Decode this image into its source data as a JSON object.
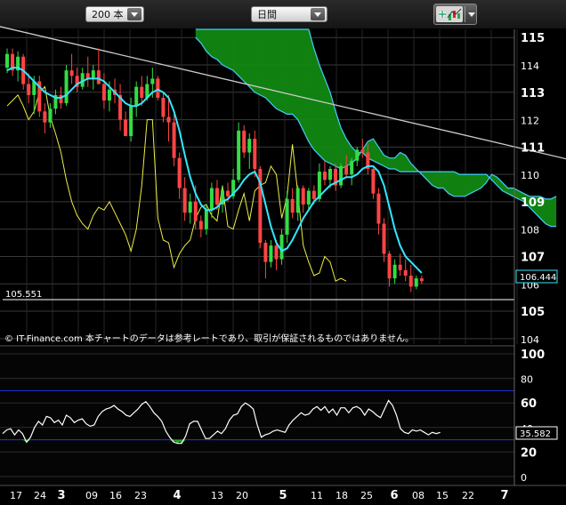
{
  "toolbar": {
    "count_select": "200 本",
    "period_select": "日間"
  },
  "icons": {
    "drawing_tools": "chart-draw-icon",
    "dropdown": "chevron-down-icon"
  },
  "colors": {
    "up_candle": "#33dd44",
    "down_candle": "#ff4444",
    "ma_line": "#33e6ff",
    "chikou_line": "#eeee44",
    "cloud_fill": "#118811",
    "cloud_edge": "#44ccff",
    "trendline": "#cccccc",
    "rsi_line": "#ffffff",
    "rsi_band": "#2233ee"
  },
  "price_panel": {
    "y_ticks": [
      "115",
      "114",
      "113",
      "112",
      "111",
      "110",
      "109",
      "108",
      "107",
      "106",
      "105",
      "104"
    ],
    "hline_label": "105.551",
    "last_price_label": "106.444",
    "copyright": "© IT-Finance.com  本チャートのデータは参考レートであり、取引が保証されるものではありません。"
  },
  "rsi_panel": {
    "y_ticks": [
      "100",
      "80",
      "60",
      "40",
      "20",
      "0"
    ],
    "last_value_label": "35.582"
  },
  "x_axis": {
    "ticks": [
      {
        "label": "17",
        "bold": false
      },
      {
        "label": "24",
        "bold": false
      },
      {
        "label": "3",
        "bold": true
      },
      {
        "label": "09",
        "bold": false
      },
      {
        "label": "16",
        "bold": false
      },
      {
        "label": "23",
        "bold": false
      },
      {
        "label": "4",
        "bold": true
      },
      {
        "label": "13",
        "bold": false
      },
      {
        "label": "20",
        "bold": false
      },
      {
        "label": "5",
        "bold": true
      },
      {
        "label": "11",
        "bold": false
      },
      {
        "label": "18",
        "bold": false
      },
      {
        "label": "25",
        "bold": false
      },
      {
        "label": "6",
        "bold": true
      },
      {
        "label": "08",
        "bold": false
      },
      {
        "label": "15",
        "bold": false
      },
      {
        "label": "22",
        "bold": false
      },
      {
        "label": "7",
        "bold": true
      }
    ]
  },
  "chart_data": {
    "type": "candlestick",
    "price": {
      "ylim": [
        103.8,
        115.3
      ],
      "y_ticks": [
        115,
        114,
        113,
        112,
        111,
        110,
        109,
        108,
        107,
        106,
        105,
        104
      ],
      "horizontal_line": 105.551,
      "last_price": 106.444,
      "candles_ohlc": [
        [
          113.9,
          114.6,
          113.7,
          114.4
        ],
        [
          114.4,
          114.6,
          113.6,
          113.8
        ],
        [
          113.8,
          114.5,
          113.4,
          114.3
        ],
        [
          114.3,
          114.4,
          113.1,
          113.3
        ],
        [
          113.3,
          113.7,
          112.6,
          112.9
        ],
        [
          112.9,
          113.6,
          112.2,
          113.4
        ],
        [
          113.4,
          113.6,
          112.1,
          112.3
        ],
        [
          112.3,
          112.6,
          111.5,
          111.9
        ],
        [
          111.9,
          112.6,
          111.7,
          112.4
        ],
        [
          112.4,
          113.1,
          112.2,
          112.9
        ],
        [
          112.9,
          113.2,
          112.4,
          112.6
        ],
        [
          112.6,
          114.0,
          112.5,
          113.8
        ],
        [
          113.8,
          114.4,
          113.3,
          113.6
        ],
        [
          113.6,
          113.9,
          113.0,
          113.2
        ],
        [
          113.2,
          113.9,
          113.1,
          113.7
        ],
        [
          113.7,
          114.3,
          113.2,
          113.5
        ],
        [
          113.5,
          114.0,
          113.1,
          113.8
        ],
        [
          113.8,
          114.6,
          113.4,
          113.3
        ],
        [
          113.3,
          113.7,
          112.4,
          112.7
        ],
        [
          112.7,
          113.4,
          112.3,
          113.1
        ],
        [
          113.1,
          113.5,
          112.6,
          112.9
        ],
        [
          112.9,
          113.3,
          111.6,
          112.0
        ],
        [
          112.0,
          112.3,
          111.4,
          111.4
        ],
        [
          111.4,
          112.8,
          111.2,
          112.5
        ],
        [
          112.5,
          113.4,
          112.1,
          113.2
        ],
        [
          113.2,
          113.6,
          112.5,
          112.8
        ],
        [
          112.8,
          113.6,
          112.7,
          113.3
        ],
        [
          113.3,
          113.9,
          112.8,
          113.5
        ],
        [
          113.5,
          113.6,
          112.7,
          112.8
        ],
        [
          112.8,
          113.0,
          111.9,
          112.1
        ],
        [
          112.1,
          112.9,
          111.2,
          111.9
        ],
        [
          111.9,
          112.2,
          110.3,
          110.6
        ],
        [
          110.6,
          110.8,
          109.1,
          109.5
        ],
        [
          109.5,
          109.9,
          108.3,
          108.6
        ],
        [
          108.6,
          109.3,
          108.2,
          109.0
        ],
        [
          109.0,
          109.6,
          108.0,
          108.3
        ],
        [
          108.3,
          108.5,
          107.7,
          108.0
        ],
        [
          108.0,
          108.9,
          107.8,
          108.7
        ],
        [
          108.7,
          109.7,
          108.4,
          109.5
        ],
        [
          109.5,
          109.8,
          108.7,
          108.9
        ],
        [
          108.9,
          109.6,
          108.6,
          109.4
        ],
        [
          109.4,
          109.7,
          109.0,
          109.2
        ],
        [
          109.2,
          110.2,
          109.1,
          109.8
        ],
        [
          109.8,
          111.9,
          109.7,
          111.6
        ],
        [
          111.6,
          111.8,
          110.6,
          110.8
        ],
        [
          110.8,
          111.5,
          110.2,
          111.3
        ],
        [
          111.3,
          111.6,
          109.9,
          110.2
        ],
        [
          110.2,
          110.3,
          107.3,
          107.5
        ],
        [
          107.5,
          107.6,
          106.2,
          106.8
        ],
        [
          106.8,
          107.6,
          106.6,
          107.4
        ],
        [
          107.4,
          107.6,
          106.5,
          106.9
        ],
        [
          106.9,
          108.0,
          106.7,
          107.8
        ],
        [
          107.8,
          109.4,
          107.5,
          109.1
        ],
        [
          109.1,
          109.5,
          108.4,
          108.6
        ],
        [
          108.6,
          109.6,
          108.3,
          109.5
        ],
        [
          109.5,
          109.6,
          108.6,
          108.9
        ],
        [
          108.9,
          109.5,
          108.7,
          109.4
        ],
        [
          109.4,
          109.6,
          108.9,
          109.1
        ],
        [
          109.1,
          110.4,
          109.0,
          110.1
        ],
        [
          110.1,
          110.5,
          109.6,
          109.8
        ],
        [
          109.8,
          110.3,
          109.5,
          110.2
        ],
        [
          110.2,
          110.4,
          109.4,
          109.6
        ],
        [
          109.6,
          110.4,
          109.5,
          110.3
        ],
        [
          110.3,
          110.7,
          109.9,
          110.0
        ],
        [
          110.0,
          110.6,
          109.6,
          110.5
        ],
        [
          110.5,
          111.0,
          110.3,
          110.9
        ],
        [
          110.9,
          111.3,
          110.6,
          110.8
        ],
        [
          110.8,
          111.1,
          110.0,
          110.2
        ],
        [
          110.2,
          110.3,
          109.1,
          109.3
        ],
        [
          109.3,
          109.5,
          107.8,
          108.2
        ],
        [
          108.2,
          108.4,
          106.8,
          107.1
        ],
        [
          107.1,
          107.2,
          105.9,
          106.2
        ],
        [
          106.2,
          106.9,
          106.0,
          106.7
        ],
        [
          106.7,
          107.1,
          106.3,
          106.5
        ],
        [
          106.5,
          106.9,
          106.1,
          106.3
        ],
        [
          106.3,
          106.7,
          105.7,
          105.9
        ],
        [
          105.9,
          106.3,
          105.8,
          106.2
        ],
        [
          106.2,
          106.3,
          106.0,
          106.1
        ]
      ],
      "ma_line": [
        113.8,
        113.9,
        113.9,
        113.8,
        113.6,
        113.4,
        113.2,
        113.0,
        112.9,
        112.8,
        112.8,
        112.9,
        113.1,
        113.3,
        113.4,
        113.5,
        113.5,
        113.5,
        113.4,
        113.2,
        113.0,
        112.8,
        112.6,
        112.5,
        112.5,
        112.6,
        112.8,
        113.0,
        113.1,
        113.0,
        112.8,
        112.3,
        111.6,
        110.7,
        109.9,
        109.3,
        108.9,
        108.7,
        108.7,
        108.8,
        109.0,
        109.1,
        109.3,
        109.5,
        109.8,
        110.0,
        110.1,
        109.7,
        108.9,
        108.1,
        107.5,
        107.2,
        107.3,
        107.6,
        108.0,
        108.4,
        108.7,
        109.0,
        109.2,
        109.4,
        109.6,
        109.7,
        109.8,
        109.9,
        109.9,
        110.0,
        110.2,
        110.3,
        110.3,
        110.1,
        109.6,
        108.8,
        108.0,
        107.4,
        107.0,
        106.8,
        106.6,
        106.4
      ],
      "chikou_line": [
        112.5,
        112.7,
        112.9,
        112.5,
        112.0,
        112.3,
        113.0,
        113.2,
        112.1,
        111.5,
        110.8,
        109.8,
        109.0,
        108.5,
        108.2,
        108.0,
        108.5,
        108.8,
        108.7,
        109.0,
        108.6,
        108.2,
        107.8,
        107.2,
        108.0,
        109.6,
        112.0,
        112.0,
        108.4,
        107.6,
        107.5,
        106.6,
        107.1,
        107.4,
        107.6,
        108.4,
        108.8,
        108.9,
        108.5,
        108.3,
        109.6,
        108.1,
        108.0,
        108.7,
        109.3,
        108.3,
        109.4,
        109.6,
        109.7,
        110.3,
        110.0,
        108.4,
        109.2,
        111.1,
        109.3,
        107.4,
        106.8,
        106.3,
        106.4,
        107.0,
        106.8,
        106.1,
        106.2,
        106.1
      ]
    },
    "cloud": {
      "x_start_index": 35,
      "span_a": [
        115.0,
        114.8,
        114.5,
        114.3,
        114.2,
        114.0,
        113.9,
        113.8,
        113.6,
        113.4,
        113.2,
        113.0,
        112.9,
        112.8,
        112.6,
        112.4,
        112.3,
        112.2,
        112.2,
        112.0,
        111.6,
        111.2,
        110.9,
        110.7,
        110.5,
        110.4,
        110.3,
        110.2,
        110.3,
        110.4,
        110.6,
        110.9,
        111.2,
        111.3,
        111.0,
        110.7,
        110.6,
        110.6,
        110.8,
        110.7,
        110.4,
        110.2,
        110.0,
        109.8,
        109.6,
        109.5,
        109.5,
        109.3,
        109.2,
        109.2,
        109.2,
        109.3,
        109.4,
        109.5,
        109.7,
        110.0,
        109.9,
        109.7,
        109.5,
        109.5,
        109.4,
        109.3,
        109.2,
        109.2,
        109.2,
        109.1,
        109.1,
        109.2
      ],
      "span_b": [
        115.3,
        115.3,
        115.3,
        115.3,
        115.3,
        115.3,
        115.3,
        115.3,
        115.3,
        115.3,
        115.3,
        115.3,
        115.3,
        115.3,
        115.3,
        115.3,
        115.3,
        115.3,
        115.3,
        115.3,
        115.3,
        115.3,
        114.6,
        114.0,
        113.5,
        113.0,
        112.3,
        111.7,
        111.3,
        111.0,
        110.8,
        110.8,
        110.6,
        110.5,
        110.4,
        110.3,
        110.2,
        110.2,
        110.1,
        110.1,
        110.1,
        110.1,
        110.1,
        110.1,
        110.1,
        110.1,
        110.1,
        110.1,
        110.1,
        110.0,
        110.0,
        110.0,
        110.0,
        110.0,
        110.0,
        109.8,
        109.6,
        109.4,
        109.3,
        109.2,
        109.1,
        109.0,
        108.8,
        108.6,
        108.4,
        108.2,
        108.1,
        108.1
      ]
    },
    "trendline": {
      "from": {
        "bar": 0,
        "price": 115.4
      },
      "to": {
        "bar": 114,
        "price": 110.1
      }
    },
    "rsi": {
      "ylim": [
        0,
        100
      ],
      "y_ticks": [
        100,
        80,
        60,
        40,
        20,
        0
      ],
      "bands": [
        70,
        30
      ],
      "last_value": 35.582,
      "values": [
        35,
        38,
        39,
        34,
        38,
        35,
        28,
        32,
        40,
        45,
        42,
        49,
        48,
        44,
        46,
        42,
        50,
        48,
        44,
        46,
        47,
        43,
        41,
        42,
        49,
        53,
        55,
        56,
        58,
        55,
        53,
        50,
        49,
        52,
        55,
        59,
        61,
        57,
        52,
        49,
        45,
        37,
        32,
        28,
        27,
        27,
        33,
        43,
        45,
        45,
        38,
        31,
        31,
        34,
        37,
        35,
        39,
        46,
        50,
        51,
        57,
        60,
        58,
        55,
        42,
        32,
        34,
        35,
        37,
        38,
        37,
        36,
        42,
        46,
        49,
        52,
        50,
        51,
        55,
        57,
        54,
        57,
        52,
        55,
        50,
        56,
        56,
        52,
        56,
        57,
        55,
        50,
        55,
        53,
        50,
        48,
        55,
        62,
        58,
        50,
        39,
        36,
        35,
        38,
        37,
        38,
        36,
        34,
        36,
        35,
        36
      ],
      "x_start": 3,
      "x_step": 4.47
    }
  }
}
